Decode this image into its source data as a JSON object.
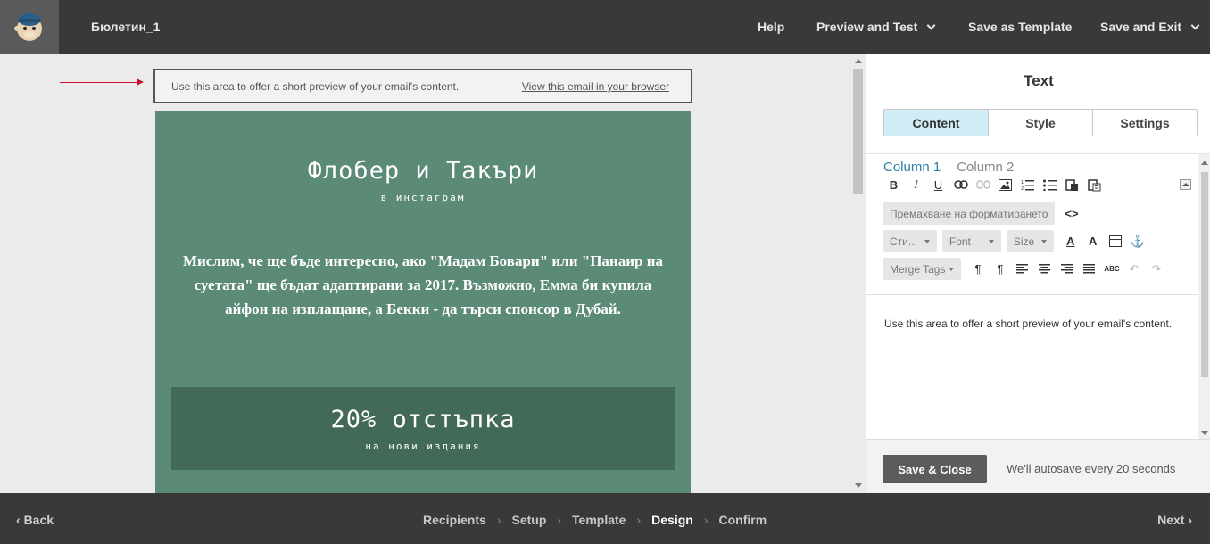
{
  "header": {
    "campaign_name": "Бюлетин_1",
    "help": "Help",
    "preview_test": "Preview and Test",
    "save_template": "Save as Template",
    "save_exit": "Save and Exit"
  },
  "canvas": {
    "preheader_text": "Use this area to offer a short preview of your email's content.",
    "preheader_link": "View this email in your browser",
    "title": "Флобер и Такъри",
    "subtitle": "в инстаграм",
    "paragraph": "Мислим, че ще бъде интересно, ако \"Мадам Бовари\" или \"Панаир на суетата\" ще бъдат адаптирани за 2017. Възможно, Емма би купила айфон на изплащане, а Бекки - да търси спонсор в Дубай.",
    "promo_title": "20% отстъпка",
    "promo_sub": "на нови издания",
    "email_bg": "#5b8a77",
    "promo_bg": "#436a58"
  },
  "panel": {
    "title": "Text",
    "tabs": [
      "Content",
      "Style",
      "Settings"
    ],
    "active_tab": "Content",
    "columns": [
      "Column 1",
      "Column 2"
    ],
    "remove_format": "Премахване на форматирането",
    "styles_dd": "Сти...",
    "font_dd": "Font",
    "size_dd": "Size",
    "merge_tags_dd": "Merge Tags",
    "editor_text": "Use this area to offer a short preview of your email's content.",
    "save_close": "Save & Close",
    "autosave": "We'll autosave every 20 seconds"
  },
  "footer": {
    "back": "Back",
    "next": "Next",
    "steps": [
      "Recipients",
      "Setup",
      "Template",
      "Design",
      "Confirm"
    ],
    "active_step": "Design"
  },
  "icons": [
    "mailchimp-logo-icon",
    "chevron-down-icon",
    "red-arrow-icon",
    "bold-icon",
    "italic-icon",
    "underline-icon",
    "link-icon",
    "unlink-icon",
    "image-icon",
    "ordered-list-icon",
    "unordered-list-icon",
    "paste-icon",
    "paste-text-icon",
    "source-code-icon",
    "font-color-icon",
    "background-color-icon",
    "table-icon",
    "anchor-icon",
    "paragraph-ltr-icon",
    "paragraph-rtl-icon",
    "align-left-icon",
    "align-center-icon",
    "align-right-icon",
    "justify-icon",
    "spellcheck-icon",
    "undo-icon",
    "redo-icon",
    "chevron-left-icon",
    "chevron-right-icon"
  ]
}
